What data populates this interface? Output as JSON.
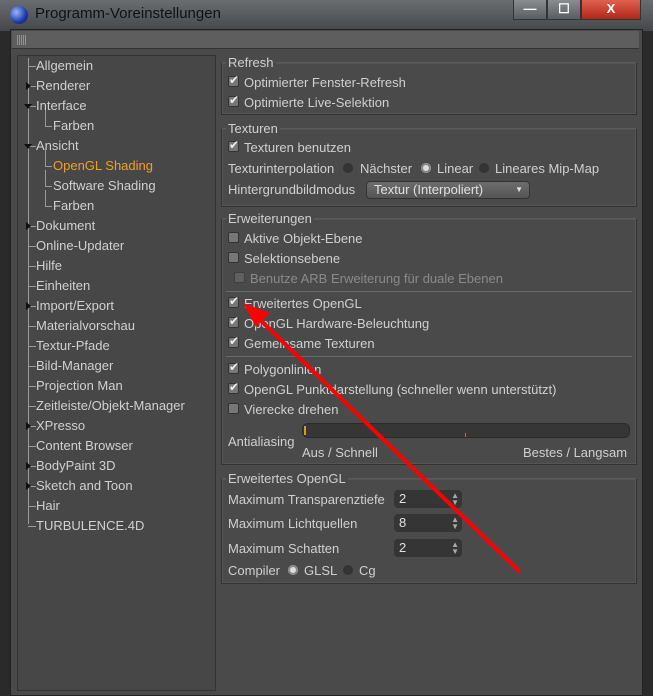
{
  "window": {
    "title": "Programm-Voreinstellungen",
    "minimize": "—",
    "maximize": "☐",
    "close": "X"
  },
  "sidebar": {
    "items": [
      {
        "label": "Allgemein",
        "level": 0
      },
      {
        "label": "Renderer",
        "level": 0,
        "arrow": "right"
      },
      {
        "label": "Interface",
        "level": 0,
        "arrow": "down"
      },
      {
        "label": "Farben",
        "level": 1
      },
      {
        "label": "Ansicht",
        "level": 0,
        "arrow": "down"
      },
      {
        "label": "OpenGL Shading",
        "level": 1,
        "selected": true
      },
      {
        "label": "Software Shading",
        "level": 1
      },
      {
        "label": "Farben",
        "level": 1
      },
      {
        "label": "Dokument",
        "level": 0,
        "arrow": "right"
      },
      {
        "label": "Online-Updater",
        "level": 0
      },
      {
        "label": "Hilfe",
        "level": 0
      },
      {
        "label": "Einheiten",
        "level": 0
      },
      {
        "label": "Import/Export",
        "level": 0,
        "arrow": "right"
      },
      {
        "label": "Materialvorschau",
        "level": 0
      },
      {
        "label": "Textur-Pfade",
        "level": 0
      },
      {
        "label": "Bild-Manager",
        "level": 0
      },
      {
        "label": "Projection Man",
        "level": 0
      },
      {
        "label": "Zeitleiste/Objekt-Manager",
        "level": 0
      },
      {
        "label": "XPresso",
        "level": 0,
        "arrow": "right"
      },
      {
        "label": "Content Browser",
        "level": 0
      },
      {
        "label": "BodyPaint 3D",
        "level": 0,
        "arrow": "right"
      },
      {
        "label": "Sketch and Toon",
        "level": 0,
        "arrow": "right"
      },
      {
        "label": "Hair",
        "level": 0
      },
      {
        "label": "TURBULENCE.4D",
        "level": 0
      }
    ],
    "selected_color": "#f0a020"
  },
  "refresh": {
    "title": "Refresh",
    "opt_window": "Optimierter Fenster-Refresh",
    "opt_live": "Optimierte Live-Selektion"
  },
  "texturen": {
    "title": "Texturen",
    "use": "Texturen benutzen",
    "interp_label": "Texturinterpolation",
    "interp_options": [
      "Nächster",
      "Linear",
      "Lineares Mip-Map"
    ],
    "interp_selected": "Linear",
    "bg_label": "Hintergrundbildmodus",
    "bg_value": "Textur (Interpoliert)"
  },
  "erweiterungen": {
    "title": "Erweiterungen",
    "active_layer": "Aktive Objekt-Ebene",
    "sel_layer": "Selektionsebene",
    "arb": "Benutze ARB Erweiterung für duale Ebenen",
    "ext_gl": "Erweitertes OpenGL",
    "hw_light": "OpenGL Hardware-Beleuchtung",
    "shared_tex": "Gemeinsame Texturen",
    "polylines": "Polygonlinien",
    "point_draw": "OpenGL Punktdarstellung (schneller wenn unterstützt)",
    "quads": "Vierecke drehen",
    "aa_label": "Antialiasing",
    "aa_min": "Aus / Schnell",
    "aa_max": "Bestes / Langsam",
    "aa_value": 0
  },
  "ext_opengl": {
    "title": "Erweitertes OpenGL",
    "transp_label": "Maximum Transparenztiefe",
    "transp": "2",
    "lights_label": "Maximum Lichtquellen",
    "lights": "8",
    "shadows_label": "Maximum Schatten",
    "shadows": "2",
    "compiler_label": "Compiler",
    "compiler_options": [
      "GLSL",
      "Cg"
    ],
    "compiler_selected": "GLSL"
  },
  "annotation": {
    "arrow_color": "#ff0000"
  }
}
